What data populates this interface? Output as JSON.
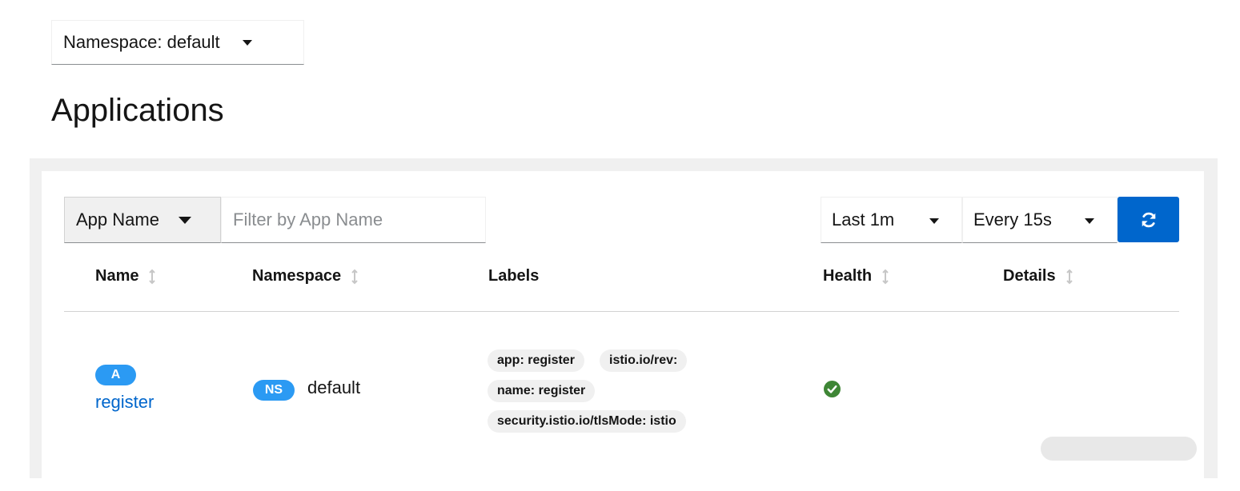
{
  "namespace_selector": {
    "label": "Namespace: default"
  },
  "page": {
    "title": "Applications"
  },
  "toolbar": {
    "filter_type": "App Name",
    "filter_placeholder": "Filter by App Name",
    "time_range": "Last 1m",
    "refresh_interval": "Every 15s",
    "refresh_icon": "sync-icon"
  },
  "table": {
    "columns": [
      {
        "label": "Name",
        "sortable": true
      },
      {
        "label": "Namespace",
        "sortable": true
      },
      {
        "label": "Labels",
        "sortable": false
      },
      {
        "label": "Health",
        "sortable": true
      },
      {
        "label": "Details",
        "sortable": true
      }
    ],
    "rows": [
      {
        "type_badge": "A",
        "name": "register",
        "namespace_badge": "NS",
        "namespace": "default",
        "labels": [
          "app: register",
          "istio.io/rev:",
          "name: register",
          "security.istio.io/tlsMode: istio"
        ],
        "health": "healthy",
        "health_icon": "check-circle-icon"
      }
    ]
  },
  "colors": {
    "accent": "#0066cc",
    "badge": "#2b9af3",
    "healthy": "#3e8635",
    "background_gray": "#f0f0f0"
  }
}
